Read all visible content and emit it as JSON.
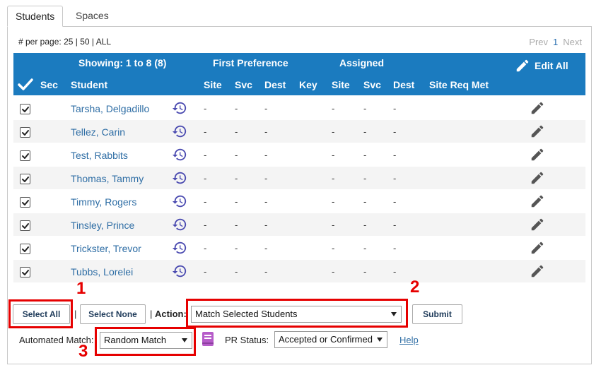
{
  "tabs": [
    {
      "label": "Students",
      "active": true
    },
    {
      "label": "Spaces",
      "active": false
    }
  ],
  "pagination": {
    "per_page_label": "# per page:",
    "options": [
      "25",
      "50",
      "ALL"
    ],
    "prev": "Prev",
    "current": "1",
    "next": "Next"
  },
  "table": {
    "showing": "Showing: 1 to 8 (8)",
    "group_first": "First Preference",
    "group_assigned": "Assigned",
    "edit_all": "Edit All",
    "columns": {
      "sec": "Sec",
      "student": "Student",
      "fp_site": "Site",
      "fp_svc": "Svc",
      "fp_dest": "Dest",
      "key": "Key",
      "as_site": "Site",
      "as_svc": "Svc",
      "as_dest": "Dest",
      "site_req": "Site Req Met"
    },
    "rows": [
      {
        "name": "Tarsha, Delgadillo",
        "fp_site": "-",
        "fp_svc": "-",
        "fp_dest": "-",
        "as_site": "-",
        "as_svc": "-",
        "as_dest": "-"
      },
      {
        "name": "Tellez, Carin",
        "fp_site": "-",
        "fp_svc": "-",
        "fp_dest": "-",
        "as_site": "-",
        "as_svc": "-",
        "as_dest": "-"
      },
      {
        "name": "Test, Rabbits",
        "fp_site": "-",
        "fp_svc": "-",
        "fp_dest": "-",
        "as_site": "-",
        "as_svc": "-",
        "as_dest": "-"
      },
      {
        "name": "Thomas, Tammy",
        "fp_site": "-",
        "fp_svc": "-",
        "fp_dest": "-",
        "as_site": "-",
        "as_svc": "-",
        "as_dest": "-"
      },
      {
        "name": "Timmy, Rogers",
        "fp_site": "-",
        "fp_svc": "-",
        "fp_dest": "-",
        "as_site": "-",
        "as_svc": "-",
        "as_dest": "-"
      },
      {
        "name": "Tinsley, Prince",
        "fp_site": "-",
        "fp_svc": "-",
        "fp_dest": "-",
        "as_site": "-",
        "as_svc": "-",
        "as_dest": "-"
      },
      {
        "name": "Trickster, Trevor",
        "fp_site": "-",
        "fp_svc": "-",
        "fp_dest": "-",
        "as_site": "-",
        "as_svc": "-",
        "as_dest": "-"
      },
      {
        "name": "Tubbs, Lorelei",
        "fp_site": "-",
        "fp_svc": "-",
        "fp_dest": "-",
        "as_site": "-",
        "as_svc": "-",
        "as_dest": "-"
      }
    ]
  },
  "controls": {
    "select_all": "Select All",
    "select_none": "Select None",
    "sep1": "|",
    "sep2": "|",
    "action_label": "Action:",
    "action_value": "Match Selected Students",
    "submit": "Submit",
    "automated_match_label": "Automated Match:",
    "automated_match_value": "Random Match",
    "pr_status_label": "PR Status:",
    "pr_status_value": "Accepted or Confirmed",
    "help": "Help"
  },
  "annotations": [
    "1",
    "2",
    "3"
  ],
  "colors": {
    "header_bg": "#1b7bbf",
    "link": "#2f6ea5",
    "icon_history": "#4a4ab0",
    "book_icon": "#b65cc9",
    "highlight": "#e60000"
  },
  "icons": {
    "check_all": "checkmark-icon",
    "edit_all": "pencil-icon",
    "row_history": "history-icon",
    "row_edit": "pencil-icon",
    "book": "book-icon"
  }
}
